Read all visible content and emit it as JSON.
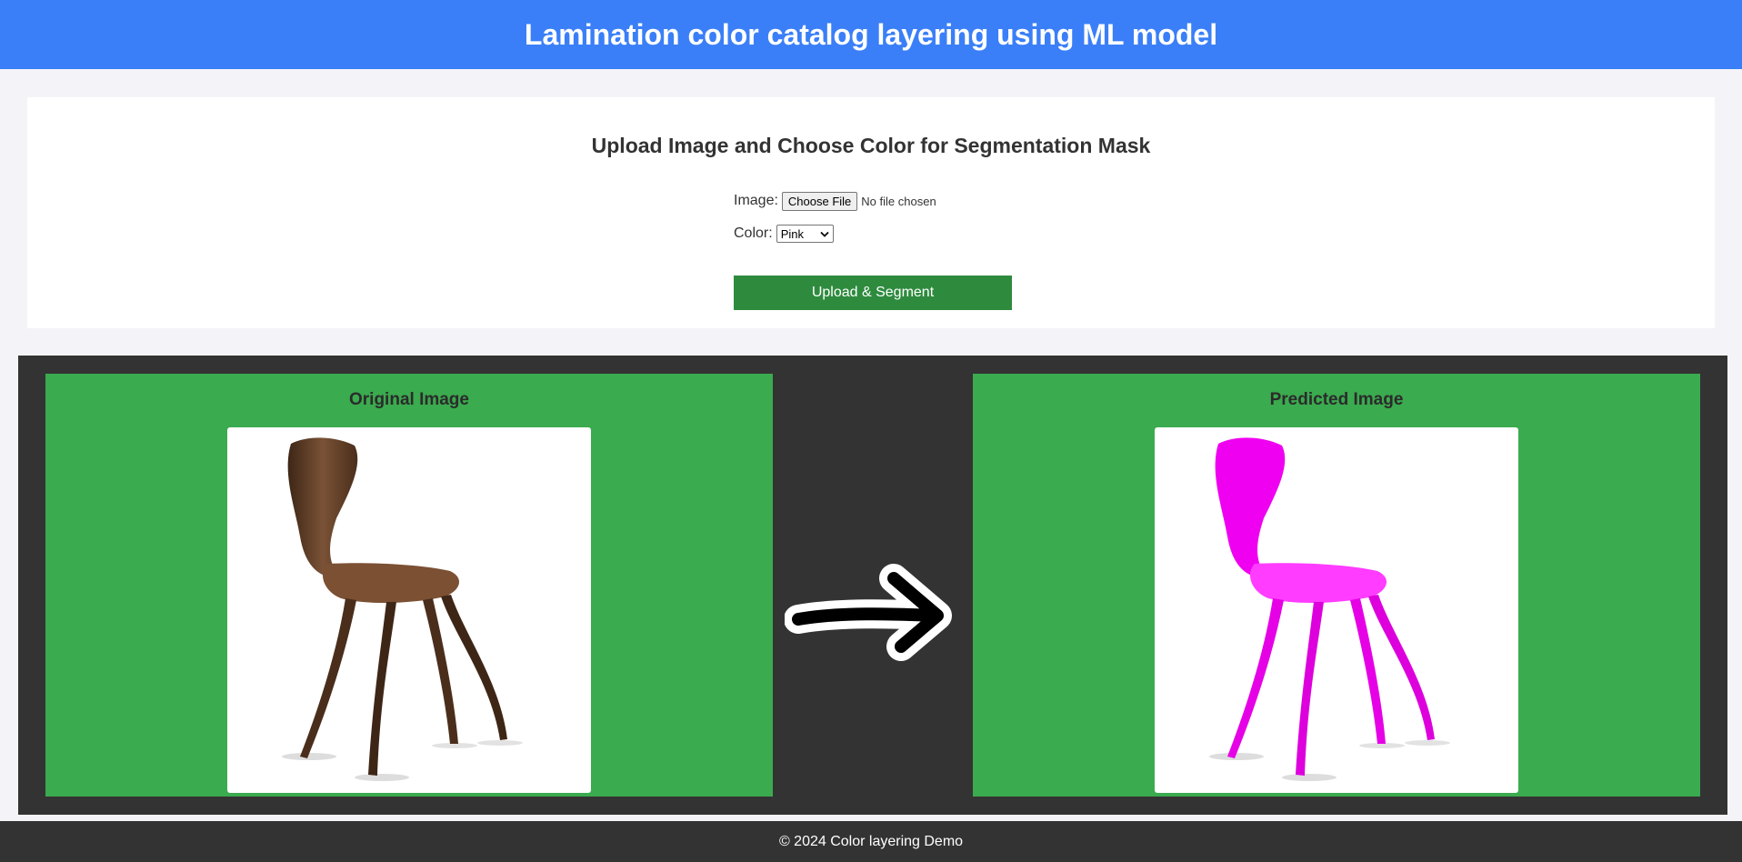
{
  "header": {
    "title": "Lamination color catalog layering using ML model"
  },
  "upload": {
    "heading": "Upload Image and Choose Color for Segmentation Mask",
    "image_label": "Image:",
    "choose_file_label": "Choose File",
    "file_status": "No file chosen",
    "color_label": "Color:",
    "color_selected": "Pink",
    "submit_label": "Upload & Segment"
  },
  "results": {
    "original_title": "Original Image",
    "predicted_title": "Predicted Image",
    "original_chair_color": "#5a3a24",
    "predicted_chair_color": "#ff00ff"
  },
  "footer": {
    "text": "© 2024 Color layering Demo"
  },
  "icons": {
    "arrow": "right-arrow-icon",
    "select": "chevron-down-icon"
  }
}
